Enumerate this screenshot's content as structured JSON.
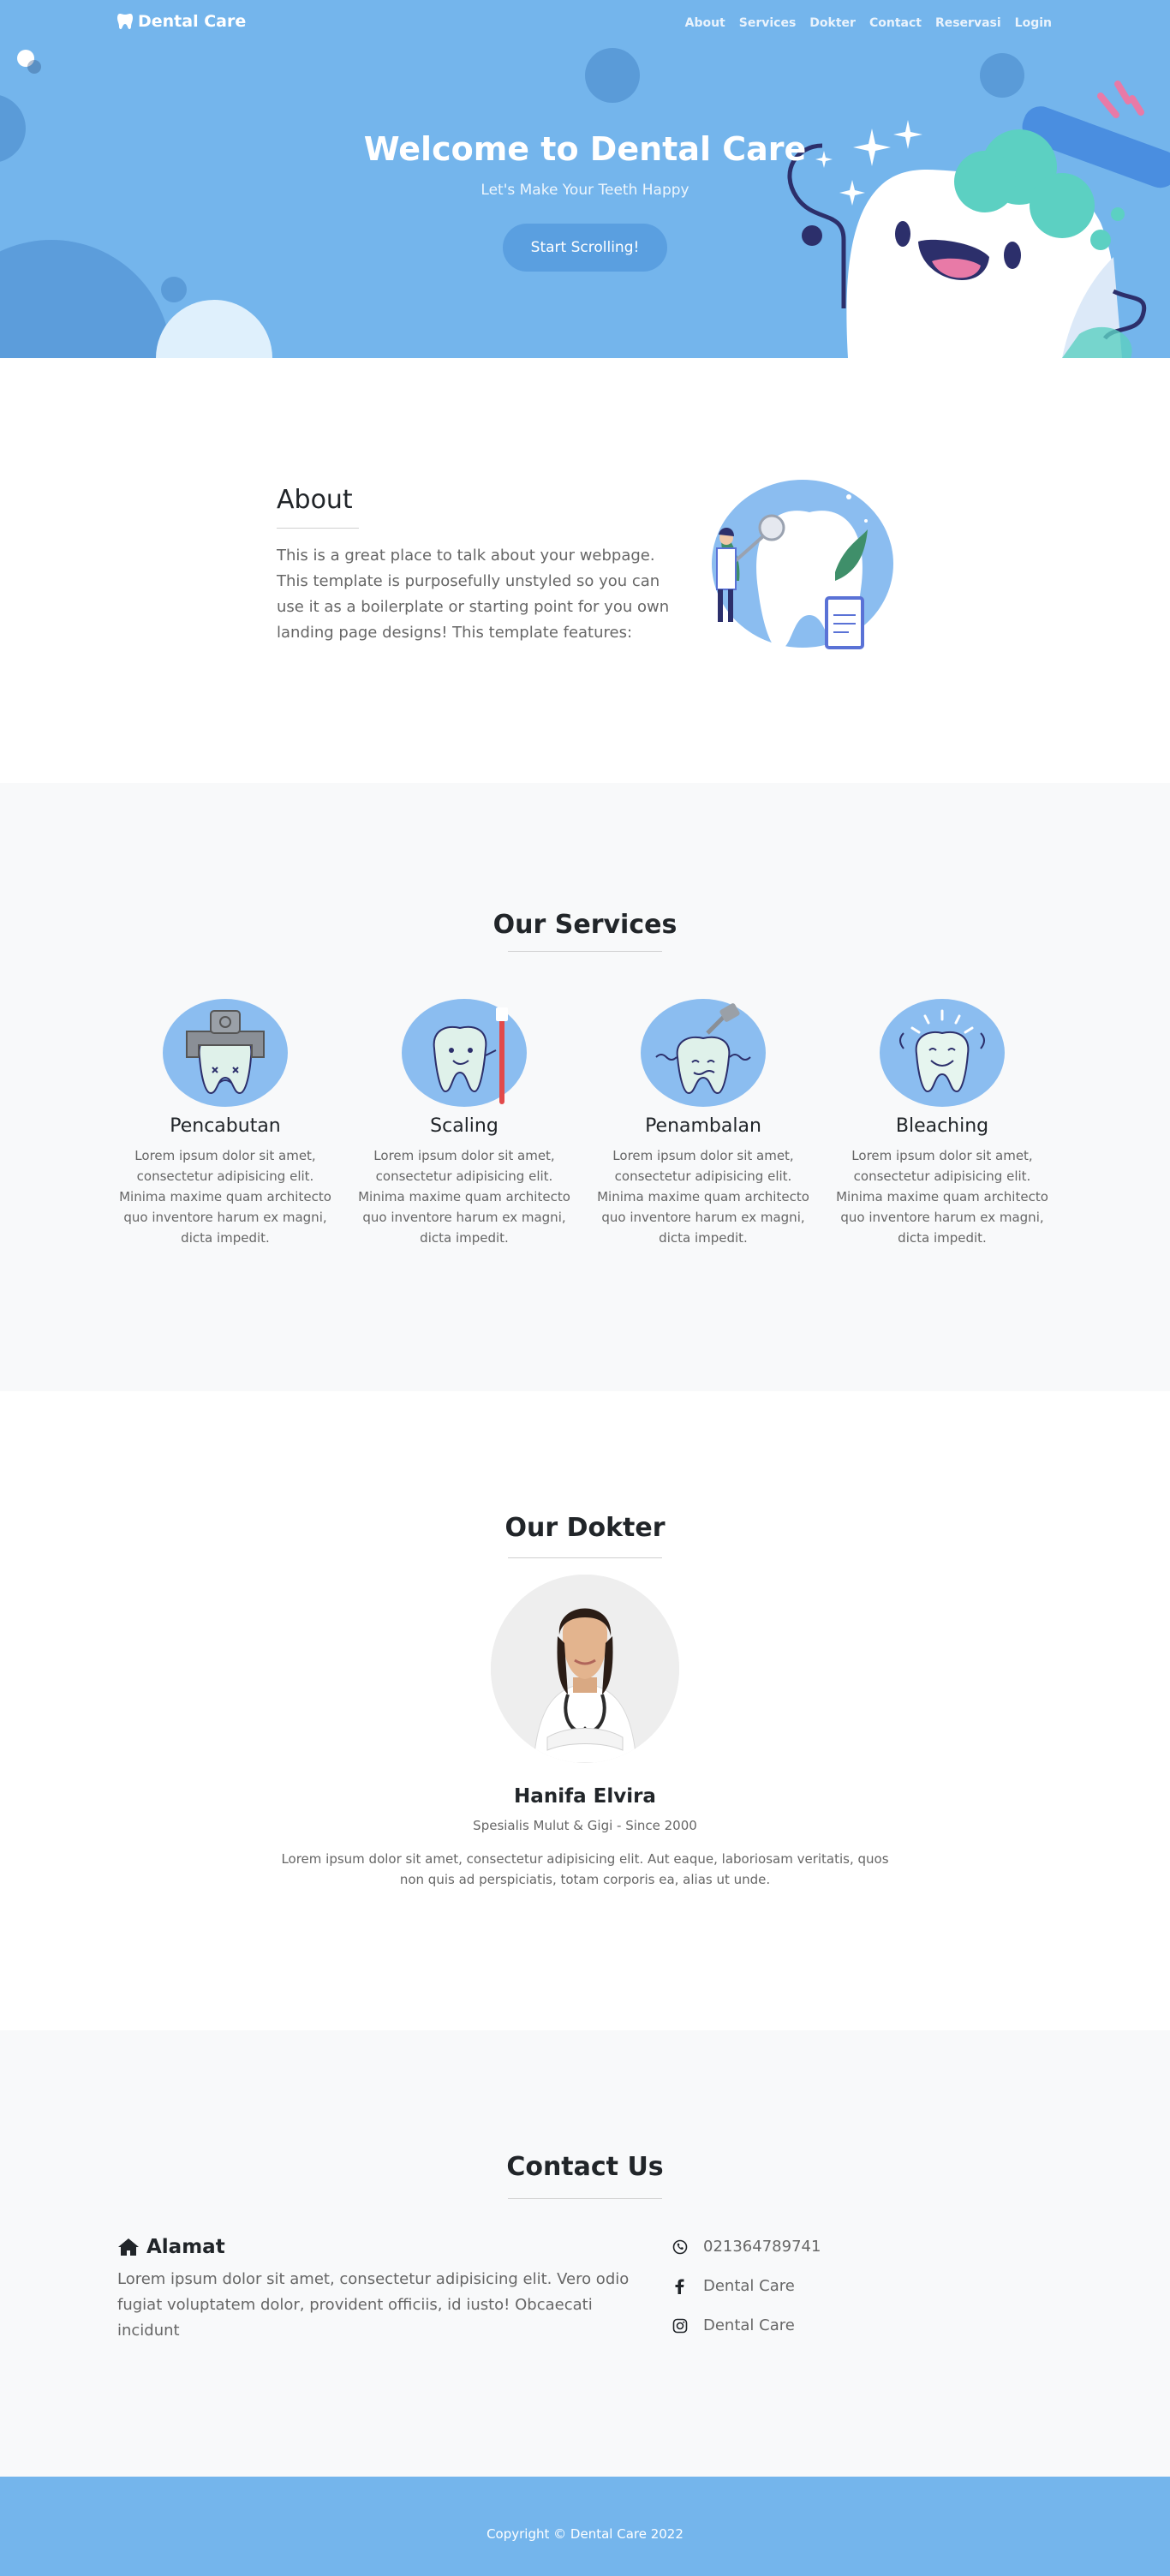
{
  "brand": {
    "name": "Dental Care",
    "icon": "tooth-icon"
  },
  "nav": {
    "items": [
      "About",
      "Services",
      "Dokter",
      "Contact",
      "Reservasi",
      "Login"
    ]
  },
  "hero": {
    "title": "Welcome to Dental Care",
    "subtitle": "Let's Make Your Teeth Happy",
    "button": "Start Scrolling!"
  },
  "about": {
    "title": "About",
    "text": "This is a great place to talk about your webpage. This template is purposefully unstyled so you can use it as a boilerplate or starting point for you own landing page designs! This template features:"
  },
  "services": {
    "title": "Our Services",
    "items": [
      {
        "name": "Pencabutan",
        "icon": "tooth-extraction-icon",
        "desc": "Lorem ipsum dolor sit amet, consectetur adipisicing elit. Minima maxime quam architecto quo inventore harum ex magni, dicta impedit."
      },
      {
        "name": "Scaling",
        "icon": "tooth-scaling-icon",
        "desc": "Lorem ipsum dolor sit amet, consectetur adipisicing elit. Minima maxime quam architecto quo inventore harum ex magni, dicta impedit."
      },
      {
        "name": "Penambalan",
        "icon": "tooth-filling-icon",
        "desc": "Lorem ipsum dolor sit amet, consectetur adipisicing elit. Minima maxime quam architecto quo inventore harum ex magni, dicta impedit."
      },
      {
        "name": "Bleaching",
        "icon": "tooth-bleaching-icon",
        "desc": "Lorem ipsum dolor sit amet, consectetur adipisicing elit. Minima maxime quam architecto quo inventore harum ex magni, dicta impedit."
      }
    ]
  },
  "dokter": {
    "title": "Our Dokter",
    "name": "Hanifa Elvira",
    "role": "Spesialis Mulut & Gigi - Since 2000",
    "desc": "Lorem ipsum dolor sit amet, consectetur adipisicing elit. Aut eaque, laboriosam veritatis, quos non quis ad perspiciatis, totam corporis ea, alias ut unde."
  },
  "contact": {
    "title": "Contact Us",
    "address_title": "Alamat",
    "address_text": "Lorem ipsum dolor sit amet, consectetur adipisicing elit. Vero odio fugiat voluptatem dolor, provident officiis, id iusto! Obcaecati incidunt",
    "phone": "021364789741",
    "facebook": "Dental Care",
    "instagram": "Dental Care"
  },
  "footer": {
    "prefix": "Copyright © ",
    "link": "Dental Care",
    "suffix": " 2022"
  },
  "colors": {
    "primary": "#74b5ec",
    "button": "#5a9fe0",
    "section_alt": "#f8f9fa"
  }
}
